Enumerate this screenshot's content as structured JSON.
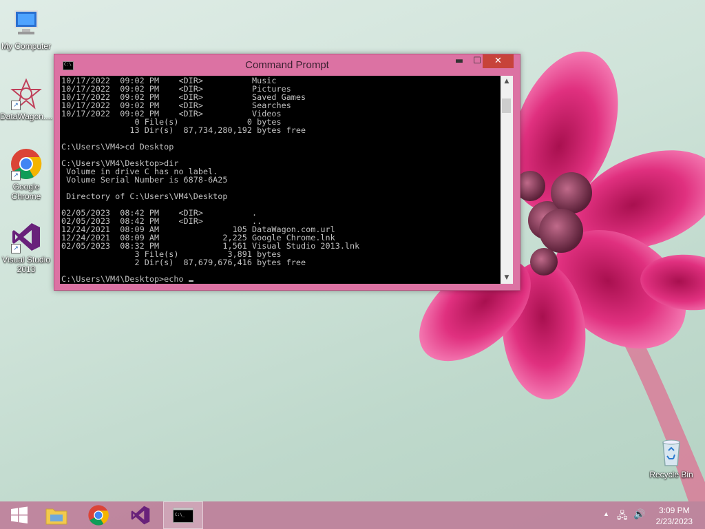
{
  "desktop": {
    "icons": [
      {
        "label": "My Computer",
        "icon": "computer-icon"
      },
      {
        "label": "DataWagon....",
        "icon": "datawagon-icon"
      },
      {
        "label": "Google Chrome",
        "icon": "chrome-icon"
      },
      {
        "label": "Visual Studio 2013",
        "icon": "visual-studio-icon"
      },
      {
        "label": "Recycle Bin",
        "icon": "recycle-bin-icon"
      }
    ]
  },
  "window": {
    "title": "Command Prompt",
    "minimize": "▬",
    "maximize": "☐",
    "close": "✕",
    "console_lines": [
      "10/17/2022  09:02 PM    <DIR>          Music",
      "10/17/2022  09:02 PM    <DIR>          Pictures",
      "10/17/2022  09:02 PM    <DIR>          Saved Games",
      "10/17/2022  09:02 PM    <DIR>          Searches",
      "10/17/2022  09:02 PM    <DIR>          Videos",
      "               0 File(s)              0 bytes",
      "              13 Dir(s)  87,734,280,192 bytes free",
      "",
      "C:\\Users\\VM4>cd Desktop",
      "",
      "C:\\Users\\VM4\\Desktop>dir",
      " Volume in drive C has no label.",
      " Volume Serial Number is 6878-6A25",
      "",
      " Directory of C:\\Users\\VM4\\Desktop",
      "",
      "02/05/2023  08:42 PM    <DIR>          .",
      "02/05/2023  08:42 PM    <DIR>          ..",
      "12/24/2021  08:09 AM               105 DataWagon.com.url",
      "12/24/2021  08:09 AM             2,225 Google Chrome.lnk",
      "02/05/2023  08:32 PM             1,561 Visual Studio 2013.lnk",
      "               3 File(s)          3,891 bytes",
      "               2 Dir(s)  87,679,676,416 bytes free",
      "",
      "C:\\Users\\VM4\\Desktop>echo "
    ]
  },
  "taskbar": {
    "items": [
      "start-button",
      "file-explorer",
      "google-chrome",
      "visual-studio",
      "command-prompt"
    ],
    "clock_time": "3:09 PM",
    "clock_date": "2/23/2023"
  }
}
